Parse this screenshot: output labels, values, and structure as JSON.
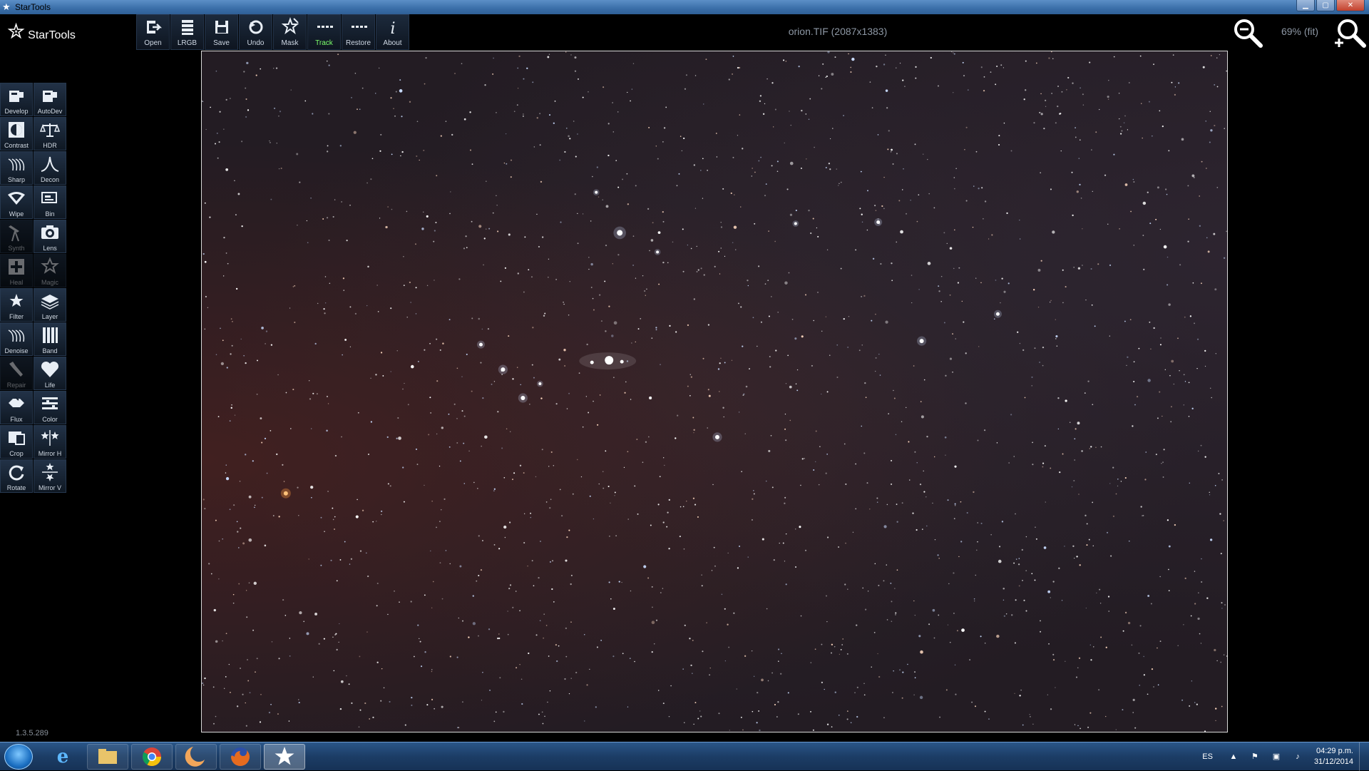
{
  "window": {
    "title": "StarTools"
  },
  "app": {
    "logo_text": "StarTools",
    "file_title": "orion.TIF (2087x1383)",
    "zoom_label": "69% (fit)",
    "version": "1.3.5.289"
  },
  "toolbar": [
    {
      "label": "Open",
      "icon": "open-icon"
    },
    {
      "label": "LRGB",
      "icon": "lrgb-icon"
    },
    {
      "label": "Save",
      "icon": "save-icon"
    },
    {
      "label": "Undo",
      "icon": "undo-icon"
    },
    {
      "label": "Mask",
      "icon": "mask-icon"
    },
    {
      "label": "Track",
      "icon": "track-icon",
      "active": true
    },
    {
      "label": "Restore",
      "icon": "restore-icon"
    },
    {
      "label": "About",
      "icon": "about-icon"
    }
  ],
  "tools": [
    {
      "label": "Develop",
      "icon": "develop-icon"
    },
    {
      "label": "AutoDev",
      "icon": "autodev-icon"
    },
    {
      "label": "Contrast",
      "icon": "contrast-icon"
    },
    {
      "label": "HDR",
      "icon": "hdr-icon"
    },
    {
      "label": "Sharp",
      "icon": "sharp-icon"
    },
    {
      "label": "Decon",
      "icon": "decon-icon"
    },
    {
      "label": "Wipe",
      "icon": "wipe-icon"
    },
    {
      "label": "Bin",
      "icon": "bin-icon"
    },
    {
      "label": "Synth",
      "icon": "synth-icon",
      "dim": true
    },
    {
      "label": "Lens",
      "icon": "lens-icon"
    },
    {
      "label": "Heal",
      "icon": "heal-icon",
      "dim": true
    },
    {
      "label": "Magic",
      "icon": "magic-icon",
      "dim": true
    },
    {
      "label": "Filter",
      "icon": "filter-icon"
    },
    {
      "label": "Layer",
      "icon": "layer-icon"
    },
    {
      "label": "Denoise",
      "icon": "denoise-icon"
    },
    {
      "label": "Band",
      "icon": "band-icon"
    },
    {
      "label": "Repair",
      "icon": "repair-icon",
      "dim": true
    },
    {
      "label": "Life",
      "icon": "life-icon"
    },
    {
      "label": "Flux",
      "icon": "flux-icon"
    },
    {
      "label": "Color",
      "icon": "color-icon"
    },
    {
      "label": "Crop",
      "icon": "crop-icon"
    },
    {
      "label": "Mirror H",
      "icon": "mirror-h-icon"
    },
    {
      "label": "Rotate",
      "icon": "rotate-icon"
    },
    {
      "label": "Mirror V",
      "icon": "mirror-v-icon"
    }
  ],
  "taskbar": {
    "items": [
      {
        "name": "internet-explorer",
        "icon": "ie-icon"
      },
      {
        "name": "file-explorer",
        "icon": "folder-icon"
      },
      {
        "name": "chrome",
        "icon": "chrome-icon"
      },
      {
        "name": "app-moon",
        "icon": "moon-icon"
      },
      {
        "name": "firefox",
        "icon": "firefox-icon"
      },
      {
        "name": "startools",
        "icon": "startools-icon",
        "active": true
      }
    ],
    "tray": {
      "language": "ES",
      "time": "04:29 p.m.",
      "date": "31/12/2014"
    }
  },
  "colors": {
    "accent_active": "#7cff6a",
    "titlebar": "#3a6ea8",
    "taskbar": "#1c3d66"
  }
}
